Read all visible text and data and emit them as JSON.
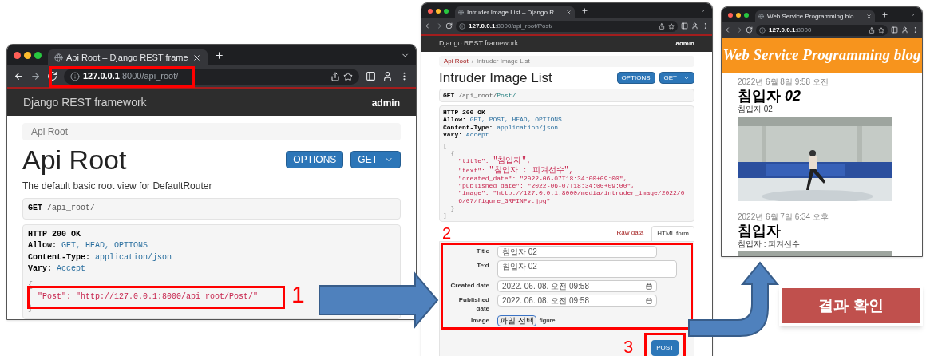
{
  "windows": [
    {
      "kind": "api",
      "tab_title": "Api Root – Django REST frame",
      "url_host": "127.0.0.1",
      "url_path": ":8000/api_root/",
      "brand": "Django REST framework",
      "user": "admin",
      "breadcrumbs": [
        {
          "label": "Api Root",
          "current": true
        }
      ],
      "heading": "Api Root",
      "description": "The default basic root view for DefaultRouter",
      "buttons": [
        {
          "label": "OPTIONS",
          "kind": "plain"
        },
        {
          "label": "GET",
          "kind": "split"
        }
      ],
      "request": {
        "method": "GET",
        "path": "/api_root/"
      },
      "response": {
        "status": "HTTP 200 OK",
        "headers": [
          {
            "name": "Allow:",
            "value": "GET, HEAD, OPTIONS"
          },
          {
            "name": "Content-Type:",
            "value": "application/json"
          },
          {
            "name": "Vary:",
            "value": "Accept"
          }
        ],
        "body": {
          "open": "{",
          "close": "}",
          "items": [
            {
              "key": "\"Post\":",
              "value": "\"http://127.0.0.1:8000/api_root/Post/\"",
              "highlighted": true
            }
          ]
        }
      }
    },
    {
      "kind": "api",
      "tab_title": "Intruder Image List – Django R",
      "url_host": "127.0.0.1",
      "url_path": ":8000/api_root/Post/",
      "brand": "Django REST framework",
      "user": "admin",
      "breadcrumb_separator": "/",
      "breadcrumbs": [
        {
          "label": "Api Root",
          "current": false
        },
        {
          "label": "Intruder Image List",
          "current": true
        }
      ],
      "heading": "Intruder Image List",
      "buttons": [
        {
          "label": "OPTIONS",
          "kind": "plain"
        },
        {
          "label": "GET",
          "kind": "split"
        }
      ],
      "request": {
        "method": "GET",
        "path": "/api_root/",
        "link": "Post/"
      },
      "response": {
        "status": "HTTP 200 OK",
        "headers": [
          {
            "name": "Allow:",
            "value": "GET, POST, HEAD, OPTIONS"
          },
          {
            "name": "Content-Type:",
            "value": "application/json"
          },
          {
            "name": "Vary:",
            "value": "Accept"
          }
        ],
        "body": {
          "open": "[",
          "close": "]",
          "items": [
            {
              "open": "{",
              "close": "}",
              "items": [
                {
                  "key": "\"title\":",
                  "value": "\"침입자\","
                },
                {
                  "key": "\"text\":",
                  "value": "\"침입자 : 피겨선수\","
                },
                {
                  "key": "\"created_date\":",
                  "value": "\"2022-06-07T18:34:00+09:00\","
                },
                {
                  "key": "\"published_date\":",
                  "value": "\"2022-06-07T18:34:00+09:00\","
                },
                {
                  "key": "\"image\":",
                  "value": "\"http://127.0.0.1:8000/media/intruder_image/2022/06/07/figure_GRFINFv.jpg\""
                }
              ]
            }
          ]
        }
      },
      "form": {
        "tabs": [
          {
            "label": "Raw data",
            "selected": false
          },
          {
            "label": "HTML form",
            "selected": true
          }
        ],
        "fields": [
          {
            "label": "Title",
            "kind": "text",
            "value": "침입자 02"
          },
          {
            "label": "Text",
            "kind": "textarea",
            "value": "침입자 02"
          },
          {
            "label": "Created date",
            "kind": "datetime",
            "value": "2022. 06. 08. 오전 09:58"
          },
          {
            "label": "Published date",
            "kind": "datetime",
            "value": "2022. 06. 08. 오전 09:58"
          },
          {
            "label": "Image",
            "kind": "file",
            "button": "파일 선택",
            "value": "figure"
          }
        ],
        "submit": "POST"
      }
    },
    {
      "kind": "blog",
      "tab_title": "Web Service Programming blo",
      "url_host": "127.0.0.1",
      "url_path": ":8000",
      "blog_title": "Web Service Programming blog",
      "posts": [
        {
          "date": "2022년 6월 8일 9:58 오전",
          "title": "침입자 *02*",
          "text": "침입자 02"
        },
        {
          "date": "2022년 6월 7일 6:34 오후",
          "title": "침입자",
          "text": "침입자 : 피겨선수"
        }
      ]
    }
  ],
  "annotations": {
    "steps": [
      "1",
      "2",
      "3"
    ],
    "result_label": "결과 확인"
  }
}
